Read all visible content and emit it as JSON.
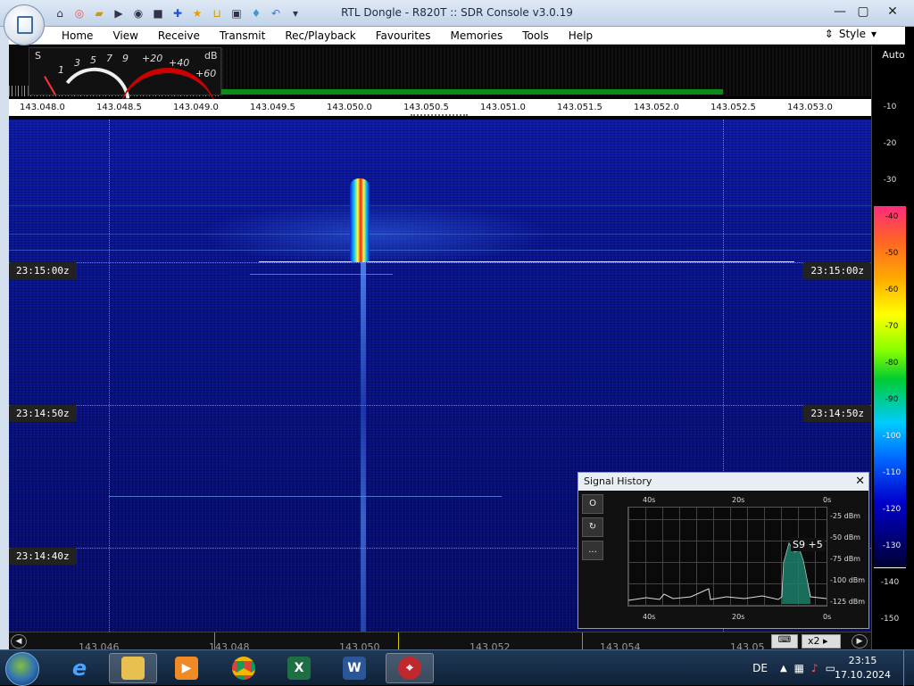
{
  "window": {
    "title": "RTL Dongle - R820T :: SDR Console v3.0.19"
  },
  "menu": {
    "items": [
      "Home",
      "View",
      "Receive",
      "Transmit",
      "Rec/Playback",
      "Favourites",
      "Memories",
      "Tools",
      "Help"
    ],
    "style_label": "Style"
  },
  "meter": {
    "s_label": "S",
    "db_label": "dB",
    "scale": [
      "1",
      "3",
      "5",
      "7",
      "9",
      "+20",
      "+40",
      "+60"
    ]
  },
  "freq_labels": [
    "143.048.0",
    "143.048.5",
    "143.049.0",
    "143.049.5",
    "143.050.0",
    "143.050.5",
    "143.051.0",
    "143.051.5",
    "143.052.0",
    "143.052.5",
    "143.053.0"
  ],
  "timestamps": [
    "23:15:00z",
    "23:14:50z",
    "23:14:40z"
  ],
  "right_scale": {
    "auto_label": "Auto",
    "top": [
      "-10",
      "-20",
      "-30"
    ],
    "color": [
      "-40",
      "-50",
      "-60",
      "-70",
      "-80",
      "-90",
      "-100",
      "-110",
      "-120",
      "-130"
    ],
    "bottom": [
      "-140",
      "-150"
    ]
  },
  "signal_history": {
    "title": "Signal History",
    "x_top": [
      "40s",
      "20s",
      "0s"
    ],
    "x_bottom": [
      "40s",
      "20s",
      "0s"
    ],
    "y": [
      "-25 dBm",
      "-50 dBm",
      "-75 dBm",
      "-100 dBm",
      "-125 dBm"
    ],
    "reading": "S9 +5",
    "buttons": [
      "O",
      "↻",
      "..."
    ]
  },
  "bottom_freqs": [
    "143.046",
    "143.048",
    "143.050",
    "143.052",
    "143.054",
    "143.05"
  ],
  "zoom": "x2",
  "taskbar": {
    "lang": "DE",
    "time": "23:15",
    "date": "17.10.2024"
  },
  "colors": {
    "waterfall": "#0a148a",
    "accent": "#0c8a1a"
  }
}
